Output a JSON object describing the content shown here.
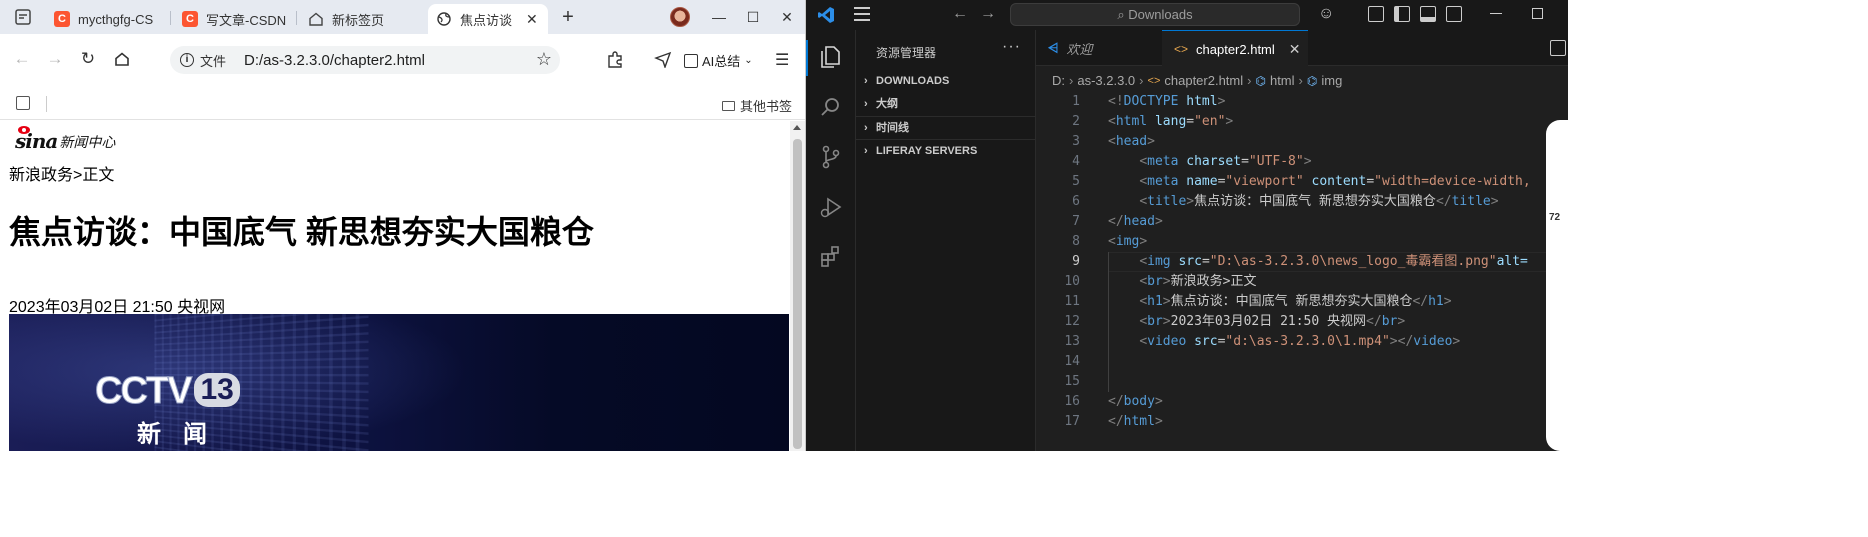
{
  "browser": {
    "tabs": [
      {
        "label": "mycthgfg-CS",
        "icon": "csdn-icon"
      },
      {
        "label": "写文章-CSDN",
        "icon": "csdn-icon"
      },
      {
        "label": "新标签页",
        "icon": "home-icon"
      },
      {
        "label": "焦点访谈",
        "icon": "globe-icon",
        "active": true
      }
    ],
    "address": {
      "scheme_label": "文件",
      "url": "D:/as-3.2.3.0/chapter2.html"
    },
    "ai_summary_label": "AI总结",
    "bookmarks": {
      "other_label": "其他书签"
    },
    "page": {
      "logo_cn": "新闻中心",
      "breadcrumb": "新浪政务>正文",
      "headline": "焦点访谈：中国底气 新思想夯实大国粮仓",
      "dateline": "2023年03月02日 21:50 央视网",
      "video_brand": "CCTV",
      "video_channel": "13",
      "video_sub": "新闻"
    }
  },
  "vscode": {
    "command_center": "Downloads",
    "explorer_title": "资源管理器",
    "explorer_sections": [
      "DOWNLOADS",
      "大纲",
      "时间线",
      "LIFERAY SERVERS"
    ],
    "tabs": [
      {
        "label": "欢迎",
        "icon": "vscode-icon"
      },
      {
        "label": "chapter2.html",
        "icon": "html-icon",
        "active": true
      }
    ],
    "breadcrumbs": [
      "D:",
      "as-3.2.3.0",
      "chapter2.html",
      "html",
      "img"
    ],
    "current_line": 9,
    "code_lines": [
      [
        [
          "t",
          "<!"
        ],
        [
          "tn",
          "DOCTYPE"
        ],
        [
          "tx",
          " "
        ],
        [
          "at",
          "html"
        ],
        [
          "t",
          ">"
        ]
      ],
      [
        [
          "t",
          "<"
        ],
        [
          "tn",
          "html"
        ],
        [
          "tx",
          " "
        ],
        [
          "at",
          "lang"
        ],
        [
          "tx",
          "="
        ],
        [
          "av",
          "\"en\""
        ],
        [
          "t",
          ">"
        ]
      ],
      [
        [
          "t",
          "<"
        ],
        [
          "tn",
          "head"
        ],
        [
          "t",
          ">"
        ]
      ],
      [
        [
          "tx",
          "    "
        ],
        [
          "t",
          "<"
        ],
        [
          "tn",
          "meta"
        ],
        [
          "tx",
          " "
        ],
        [
          "at",
          "charset"
        ],
        [
          "tx",
          "="
        ],
        [
          "av",
          "\"UTF-8\""
        ],
        [
          "t",
          ">"
        ]
      ],
      [
        [
          "tx",
          "    "
        ],
        [
          "t",
          "<"
        ],
        [
          "tn",
          "meta"
        ],
        [
          "tx",
          " "
        ],
        [
          "at",
          "name"
        ],
        [
          "tx",
          "="
        ],
        [
          "av",
          "\"viewport\""
        ],
        [
          "tx",
          " "
        ],
        [
          "at",
          "content"
        ],
        [
          "tx",
          "="
        ],
        [
          "av",
          "\"width=device-width, "
        ]
      ],
      [
        [
          "tx",
          "    "
        ],
        [
          "t",
          "<"
        ],
        [
          "tn",
          "title"
        ],
        [
          "t",
          ">"
        ],
        [
          "tx",
          "焦点访谈：中国底气 新思想夯实大国粮仓"
        ],
        [
          "t",
          "</"
        ],
        [
          "tn",
          "title"
        ],
        [
          "t",
          ">"
        ]
      ],
      [
        [
          "t",
          "</"
        ],
        [
          "tn",
          "head"
        ],
        [
          "t",
          ">"
        ]
      ],
      [
        [
          "t",
          "<"
        ],
        [
          "tn",
          "img"
        ],
        [
          "t",
          ">"
        ]
      ],
      [
        [
          "tx",
          "    "
        ],
        [
          "t",
          "<"
        ],
        [
          "tn",
          "img"
        ],
        [
          "tx",
          " "
        ],
        [
          "at",
          "src"
        ],
        [
          "tx",
          "="
        ],
        [
          "av",
          "\"D:\\as-3.2.3.0\\news_logo_毒霸看图.png\""
        ],
        [
          "at",
          "alt="
        ]
      ],
      [
        [
          "tx",
          "    "
        ],
        [
          "t",
          "<"
        ],
        [
          "tn",
          "br"
        ],
        [
          "t",
          ">"
        ],
        [
          "tx",
          "新浪政务>正文"
        ]
      ],
      [
        [
          "tx",
          "    "
        ],
        [
          "t",
          "<"
        ],
        [
          "tn",
          "h1"
        ],
        [
          "t",
          ">"
        ],
        [
          "tx",
          "焦点访谈：中国底气 新思想夯实大国粮仓"
        ],
        [
          "t",
          "</"
        ],
        [
          "tn",
          "h1"
        ],
        [
          "t",
          ">"
        ]
      ],
      [
        [
          "tx",
          "    "
        ],
        [
          "t",
          "<"
        ],
        [
          "tn",
          "br"
        ],
        [
          "t",
          ">"
        ],
        [
          "tx",
          "2023年03月02日 21:50 央视网"
        ],
        [
          "t",
          "</"
        ],
        [
          "tn",
          "br"
        ],
        [
          "t",
          ">"
        ]
      ],
      [
        [
          "tx",
          "    "
        ],
        [
          "t",
          "<"
        ],
        [
          "tn",
          "video"
        ],
        [
          "tx",
          " "
        ],
        [
          "at",
          "src"
        ],
        [
          "tx",
          "="
        ],
        [
          "av",
          "\"d:\\as-3.2.3.0\\1.mp4\""
        ],
        [
          "t",
          "></"
        ],
        [
          "tn",
          "video"
        ],
        [
          "t",
          ">"
        ]
      ],
      [],
      [],
      [
        [
          "t",
          "</"
        ],
        [
          "tn",
          "body"
        ],
        [
          "t",
          ">"
        ]
      ],
      [
        [
          "t",
          "</"
        ],
        [
          "tn",
          "html"
        ],
        [
          "t",
          ">"
        ]
      ]
    ]
  },
  "overlay": {
    "score": "72"
  }
}
